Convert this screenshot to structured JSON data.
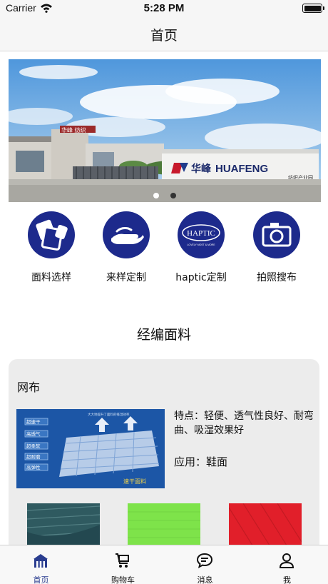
{
  "status_bar": {
    "carrier": "Carrier",
    "time": "5:28 PM"
  },
  "nav": {
    "title": "首页"
  },
  "banner": {
    "sign_cn": "华峰",
    "sign_en": "HUAFENG",
    "sign_sub": "纺织产业园",
    "roof_sign": "华峰 纺织",
    "page_count": 2,
    "active_page": 1
  },
  "quick_actions": [
    {
      "label": "面料选样",
      "icon": "fabric-swatch-icon"
    },
    {
      "label": "来样定制",
      "icon": "hand-offer-icon"
    },
    {
      "label": "haptic定制",
      "icon": "haptic-logo-icon",
      "logo_text": "HAPTIC",
      "logo_sub": "LOVELY MOST & MORE"
    },
    {
      "label": "拍照搜布",
      "icon": "camera-icon"
    }
  ],
  "section": {
    "title": "经编面料"
  },
  "product_card": {
    "title": "网布",
    "feature": "特点：轻便、透气性良好、耐弯曲、吸湿效果好",
    "usage": "应用：鞋面",
    "image_badges": [
      "超速干",
      "高透气",
      "超柔软",
      "超耐磨",
      "高弹性"
    ],
    "image_caption": "速干面料",
    "swatches": [
      {
        "name": "dark-teal-mesh",
        "color": "#2f5a60"
      },
      {
        "name": "lime-green-mesh",
        "color": "#7ee34a"
      },
      {
        "name": "red-mesh",
        "color": "#e11f2a"
      }
    ]
  },
  "tab_bar": {
    "items": [
      {
        "label": "首页",
        "icon": "home-icon",
        "active": true
      },
      {
        "label": "购物车",
        "icon": "cart-icon",
        "active": false
      },
      {
        "label": "消息",
        "icon": "message-icon",
        "active": false
      },
      {
        "label": "我",
        "icon": "person-icon",
        "active": false
      }
    ],
    "active_color": "#2a3d8f",
    "inactive_color": "#111111"
  },
  "colors": {
    "brand_navy": "#1d2a8c",
    "card_bg": "#ececec",
    "sky": "#6aa9e0"
  }
}
